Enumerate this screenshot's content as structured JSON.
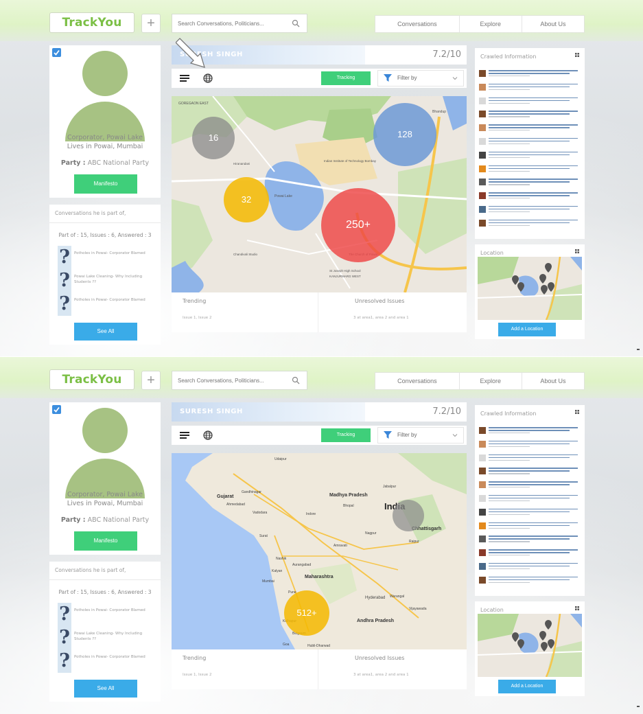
{
  "frames": [
    {
      "header": {
        "logo": "TrackYou",
        "plus": "+",
        "search_placeholder": "Search Conversations, Politicians...",
        "nav": [
          "Conversations",
          "Explore",
          "About Us"
        ]
      },
      "profile": {
        "role_line1": "Corporator, Powai Lake",
        "role_line2": "Lives in Powai, Mumbai",
        "party_label": "Party :",
        "party_value": "ABC National Party",
        "manifesto_button": "Manifesto"
      },
      "conversations": {
        "title": "Conversations he is part of,",
        "stats": "Part of : 15, Issues : 6, Answered : 3",
        "items": [
          "Potholes in Powai- Corporator Blamed",
          "Powai Lake Cleaning- Why Including Students ??",
          "Potholes in Powai- Corporator Blamed"
        ],
        "see_all": "See All"
      },
      "politician": {
        "name": "SURESH SINGH",
        "score": "7.2/10"
      },
      "toolbar": {
        "tracking": "Tracking",
        "filter": "Filter by"
      },
      "map": {
        "type": "city",
        "labels": [
          "GOREGAON EAST",
          "Powai Lake",
          "Indian Institute of Technology Bombay",
          "Bhandup",
          "Hiranandani",
          "Chandivali Studio",
          "St Joseph High School",
          "KANJURMARG WEST",
          "The Church of Powai"
        ],
        "bubbles": [
          {
            "value": "16",
            "color": "#8a8a8a"
          },
          {
            "value": "128",
            "color": "#6d99d6"
          },
          {
            "value": "32",
            "color": "#f5b800"
          },
          {
            "value": "250+",
            "color": "#ee4545"
          }
        ]
      },
      "trending": {
        "label": "Trending",
        "value": "Issue 1, Issue 2"
      },
      "unresolved": {
        "label": "Unresolved Issues",
        "value": "3 at area1, area 2 and area 1"
      },
      "crawled": {
        "title": "Crawled Information",
        "count": 12
      },
      "location": {
        "title": "Location",
        "button": "Add a Location"
      }
    },
    {
      "header": {
        "logo": "TrackYou",
        "plus": "+",
        "search_placeholder": "Search Conversations, Politicians...",
        "nav": [
          "Conversations",
          "Explore",
          "About Us"
        ]
      },
      "profile": {
        "role_line1": "Corporator, Powai Lake",
        "role_line2": "Lives in Powai, Mumbai",
        "party_label": "Party :",
        "party_value": "ABC National Party",
        "manifesto_button": "Manifesto"
      },
      "conversations": {
        "title": "Conversations he is part of,",
        "stats": "Part of : 15, Issues : 6, Answered : 3",
        "items": [
          "Potholes in Powai- Corporator Blamed",
          "Powai Lake Cleaning- Why Including Students ??",
          "Potholes in Powai- Corporator Blamed"
        ],
        "see_all": "See All"
      },
      "politician": {
        "name": "SURESH SINGH",
        "score": "7.2/10"
      },
      "toolbar": {
        "tracking": "Tracking",
        "filter": "Filter by"
      },
      "map": {
        "type": "country",
        "labels": [
          "Madhya Pradesh",
          "India",
          "Chhattisgarh",
          "Gujarat",
          "Ahmedabad",
          "Gandhinagar",
          "Vadodara",
          "Bhopal",
          "Indore",
          "Surat",
          "Nagpur",
          "Raipur",
          "Amravati",
          "Nashik",
          "Aurangabad",
          "Maharashtra",
          "Kalyan",
          "Mumbai",
          "Pune",
          "Hyderabad",
          "Andhra Pradesh",
          "Goa",
          "Warangal",
          "Vijayawada",
          "Kolhapur",
          "Belgaum",
          "Hubli-Dharwad",
          "Jabalpur",
          "Udaipur"
        ],
        "bubbles": [
          {
            "value": "512+",
            "color": "#f5b800"
          },
          {
            "value": "",
            "color": "#8a8a8a"
          }
        ]
      },
      "trending": {
        "label": "Trending",
        "value": "Issue 1, Issue 2"
      },
      "unresolved": {
        "label": "Unresolved Issues",
        "value": "3 at area1, area 2 and area 1"
      },
      "crawled": {
        "title": "Crawled Information",
        "count": 12
      },
      "location": {
        "title": "Location",
        "button": "Add a Location"
      }
    }
  ]
}
